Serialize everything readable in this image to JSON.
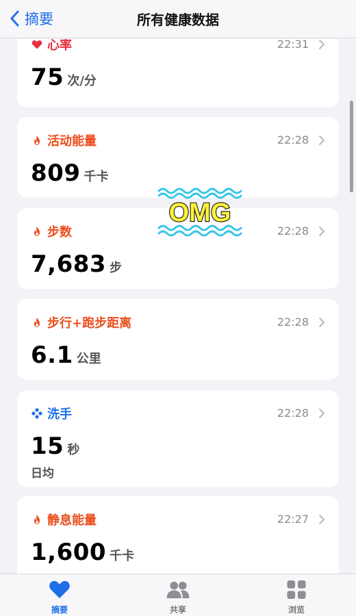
{
  "nav": {
    "back_label": "摘要",
    "title": "所有健康数据"
  },
  "cards": [
    {
      "label": "心率",
      "time": "22:31",
      "value": "75",
      "unit": "次/分",
      "color": "#e5313f",
      "icon": "heart-icon"
    },
    {
      "label": "活动能量",
      "time": "22:28",
      "value": "809",
      "unit": "千卡",
      "color": "#ec4d1c",
      "icon": "flame-icon"
    },
    {
      "label": "步数",
      "time": "22:28",
      "value": "7,683",
      "unit": "步",
      "color": "#ec4d1c",
      "icon": "flame-icon"
    },
    {
      "label": "步行+跑步距离",
      "time": "22:28",
      "value": "6.1",
      "unit": "公里",
      "color": "#ec4d1c",
      "icon": "flame-icon"
    },
    {
      "label": "洗手",
      "time": "22:28",
      "value": "15",
      "unit": "秒",
      "sub": "日均",
      "color": "#1f6fe8",
      "icon": "sparkle-icon"
    },
    {
      "label": "静息能量",
      "time": "22:27",
      "value": "1,600",
      "unit": "千卡",
      "color": "#ec4d1c",
      "icon": "flame-icon"
    }
  ],
  "sticker": {
    "text": "OMG",
    "fill": "#fff23a",
    "wave_color": "#38c6e8"
  },
  "tabbar": {
    "tabs": [
      {
        "label": "摘要",
        "icon": "heart-icon",
        "active": true
      },
      {
        "label": "共享",
        "icon": "people-icon",
        "active": false
      },
      {
        "label": "浏览",
        "icon": "grid-icon",
        "active": false
      }
    ]
  }
}
